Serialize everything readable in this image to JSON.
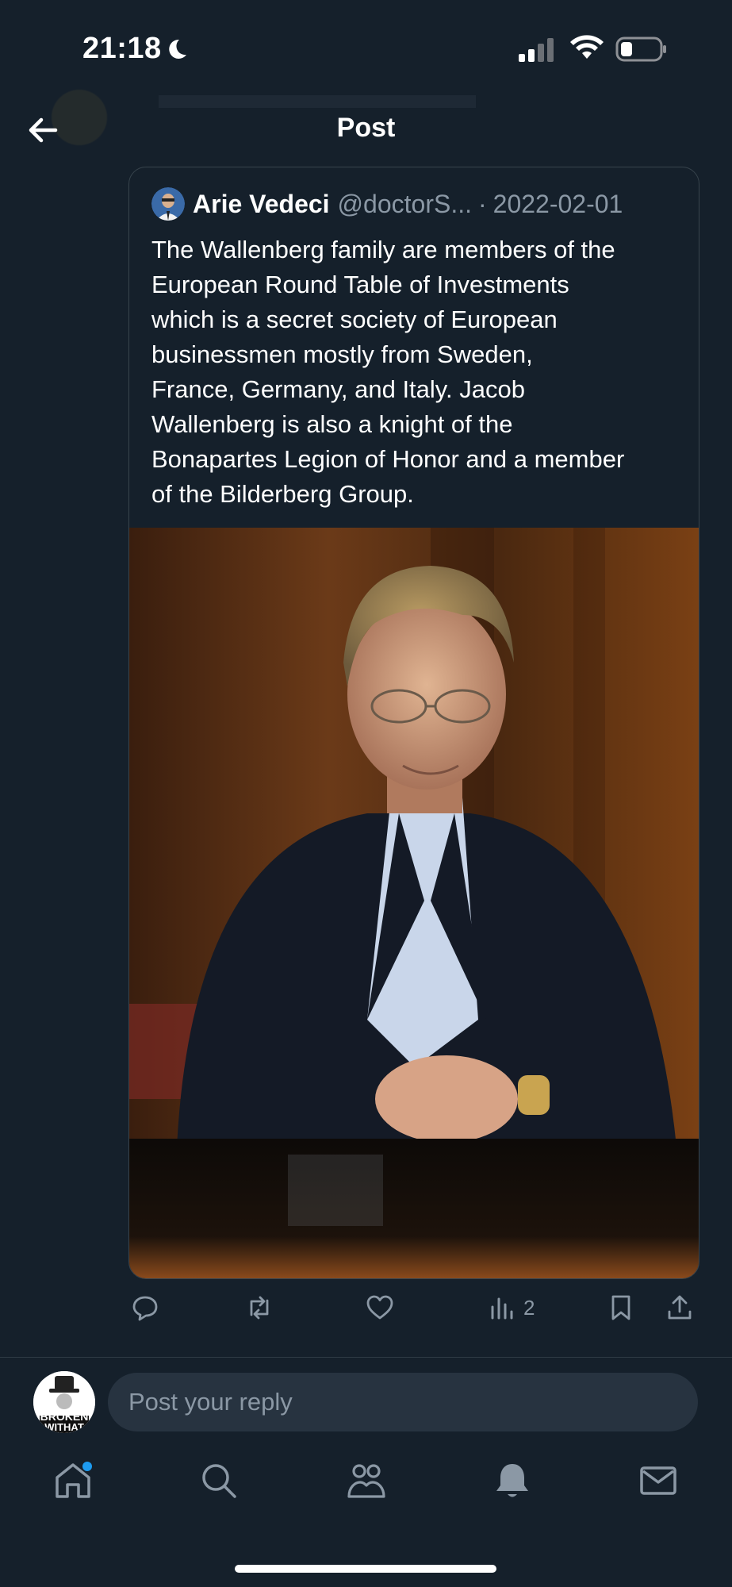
{
  "status_bar": {
    "time": "21:18",
    "icons": [
      "moon-icon",
      "signal-icon",
      "wifi-icon",
      "battery-icon"
    ]
  },
  "header": {
    "title": "Post",
    "back_icon": "arrow-left-icon"
  },
  "quoted_post": {
    "author_name": "Arie Vedeci",
    "handle": "@doctorS...",
    "separator": "·",
    "date": "2022-02-01",
    "text": "The Wallenberg family are members of the\nEuropean Round Table of Investments\nwhich is a secret society of European\nbusinessmen mostly from Sweden,\nFrance, Germany, and Italy. Jacob\nWallenberg is also a knight of the\nBonapartes Legion of Honor and a member\nof the Bilderberg Group.",
    "image_subject": "Portrait photo of a man in a dark blazer with hands folded on a table"
  },
  "actions": {
    "reply_icon": "comment-icon",
    "repost_icon": "repost-icon",
    "like_icon": "heart-icon",
    "views_icon": "views-chart-icon",
    "views_count": "2",
    "bookmark_icon": "bookmark-icon",
    "share_icon": "share-icon"
  },
  "reply": {
    "placeholder": "Post your reply",
    "avatar_text_1": "BROKEN",
    "avatar_text_2": "WITHAT"
  },
  "tab_bar": {
    "items": [
      "home-icon",
      "search-icon",
      "communities-icon",
      "notifications-icon",
      "messages-icon"
    ]
  },
  "colors": {
    "background": "#15202b",
    "accent": "#1d9bf0",
    "muted_text": "#8b98a5",
    "border": "#38444d"
  }
}
